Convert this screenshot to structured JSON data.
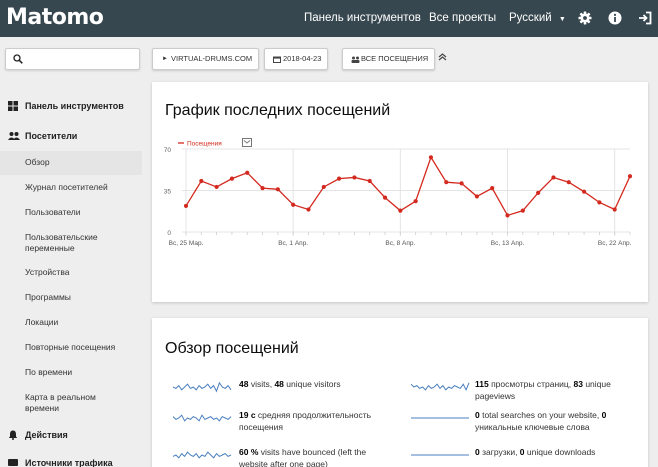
{
  "app": {
    "logo": "Matomo"
  },
  "topnav": {
    "dashboard": "Панель инструментов",
    "all_websites": "Все проекты",
    "language": "Русский"
  },
  "toolbar": {
    "search_placeholder": "",
    "site": "VIRTUAL-DRUMS.COM",
    "date": "2018-04-23",
    "segment": "ВСЕ ПОСЕЩЕНИЯ"
  },
  "sidebar": {
    "dashboard": "Панель инструментов",
    "visitors": "Посетители",
    "items": [
      "Обзор",
      "Журнал посетителей",
      "Пользователи",
      "Пользовательские переменные",
      "Устройства",
      "Программы",
      "Локации",
      "Повторные посещения",
      "По времени",
      "Карта в реальном времени"
    ],
    "actions": "Действия",
    "referrers": "Источники трафика"
  },
  "evolution": {
    "title": "График последних посещений",
    "legend": "Посещения"
  },
  "overview": {
    "title": "Обзор посещений",
    "left": [
      {
        "v1": "48",
        "t1": " visits, ",
        "v2": "48",
        "t2": " unique visitors"
      },
      {
        "v1": "19 с",
        "t1": " средняя продолжительность посещения",
        "v2": "",
        "t2": ""
      },
      {
        "v1": "60 %",
        "t1": " visits have bounced (left the website after one page)",
        "v2": "",
        "t2": ""
      }
    ],
    "right": [
      {
        "v1": "115",
        "t1": " просмотры страниц, ",
        "v2": "83",
        "t2": " unique pageviews"
      },
      {
        "v1": "0",
        "t1": " total searches on your website, ",
        "v2": "0",
        "t2": " уникальные ключевые слова"
      },
      {
        "v1": "0",
        "t1": " загрузки, ",
        "v2": "0",
        "t2": " unique downloads"
      }
    ]
  },
  "chart_data": {
    "type": "line",
    "title": "",
    "xlabel": "",
    "ylabel": "",
    "ylim": [
      0,
      70
    ],
    "yticks": [
      "0",
      "35",
      "70"
    ],
    "xtick_labels": [
      "Вс, 25 Мар.",
      "Вс, 1 Апр.",
      "Вс, 8 Апр.",
      "Вс, 13 Апр.",
      "Вс, 22 Апр."
    ],
    "xtick_index": [
      0,
      7,
      14,
      21,
      28
    ],
    "series": [
      {
        "name": "Посещения",
        "color": "#d4291f",
        "values": [
          22,
          43,
          38,
          45,
          50,
          37,
          36,
          23,
          19,
          38,
          45,
          46,
          43,
          29,
          18,
          26,
          63,
          42,
          41,
          30,
          37,
          14,
          18,
          33,
          46,
          42,
          34,
          25,
          19,
          47
        ]
      }
    ]
  }
}
